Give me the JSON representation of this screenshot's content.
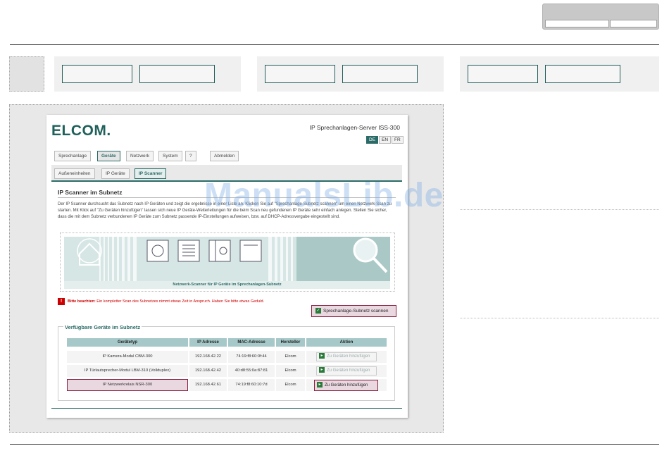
{
  "header": {
    "logo": "ELCOM.",
    "server_title": "IP Sprechanlagen-Server ISS-300"
  },
  "languages": [
    "DE",
    "EN",
    "FR"
  ],
  "main_tabs": [
    "Sprechanlage",
    "Geräte",
    "Netzwerk",
    "System",
    "?",
    "Abmelden"
  ],
  "sub_tabs": [
    "Außeneinheiten",
    "IP Geräte",
    "IP Scanner"
  ],
  "section": {
    "title": "IP Scanner im Subnetz",
    "description": "Der IP Scanner durchsucht das Subnetz nach IP Geräten und zeigt die ergebnisse in einer Liste an. Klicken Sie auf \"Sprechanlage-Subnetz scannen\" um einen Netzwerk-Scan zu starten. Mit Klick auf \"Zu Geräten hinzufügen\" lassen sich neue IP Geräte-Weiterleitungen für die beim Scan neu gefundenen IP Geräte sehr einfach anlegen. Stellen Sie sicher, dass die mit dem Subnetz verbundenen IP Geräte zum Subnetz passende IP-Einstellungen aufweisen, bzw. auf DHCP-Adressvergabe eingestellt sind."
  },
  "banner_caption": "Netzwerk-Scanner für IP Geräte im Sprechanlagen-Subnetz",
  "warning": {
    "bold": "Bitte beachten:",
    "text": " Ein kompletter Scan des Subnetzes nimmt etwas Zeit in Anspruch. Haben Sie bitte etwas Geduld."
  },
  "scan_button": "Sprechanlage-Subnetz scannen",
  "devices": {
    "legend": "Verfügbare Geräte im Subnetz",
    "columns": [
      "Gerätetyp",
      "IP Adresse",
      "MAC-Adresse",
      "Hersteller",
      "Aktion"
    ],
    "rows": [
      {
        "type": "IP Kamera-Modul CBM-300",
        "ip": "192.168.42.22",
        "mac": "74:19:f8:60:0f:44",
        "vendor": "Elcom",
        "action": "Zu Geräten hinzufügen"
      },
      {
        "type": "IP Türlautsprecher-Modul LBM-310 (Vollduplex)",
        "ip": "192.168.42.42",
        "mac": "40:d8:55:0a:87:81",
        "vendor": "Elcom",
        "action": "Zu Geräten hinzufügen"
      },
      {
        "type": "IP Netzwerkrelais NSR-300",
        "ip": "192.168.42.61",
        "mac": "74:19:f8:60:10:7d",
        "vendor": "Elcom",
        "action": "Zu Geräten hinzufügen"
      }
    ]
  },
  "watermark": "ManualsLib.de",
  "colors": {
    "brand": "#2a6b67",
    "highlight_bg": "#ead8e0",
    "highlight_border": "#8a2040",
    "warning": "#cc0000",
    "table_header": "#a6c8c8"
  }
}
